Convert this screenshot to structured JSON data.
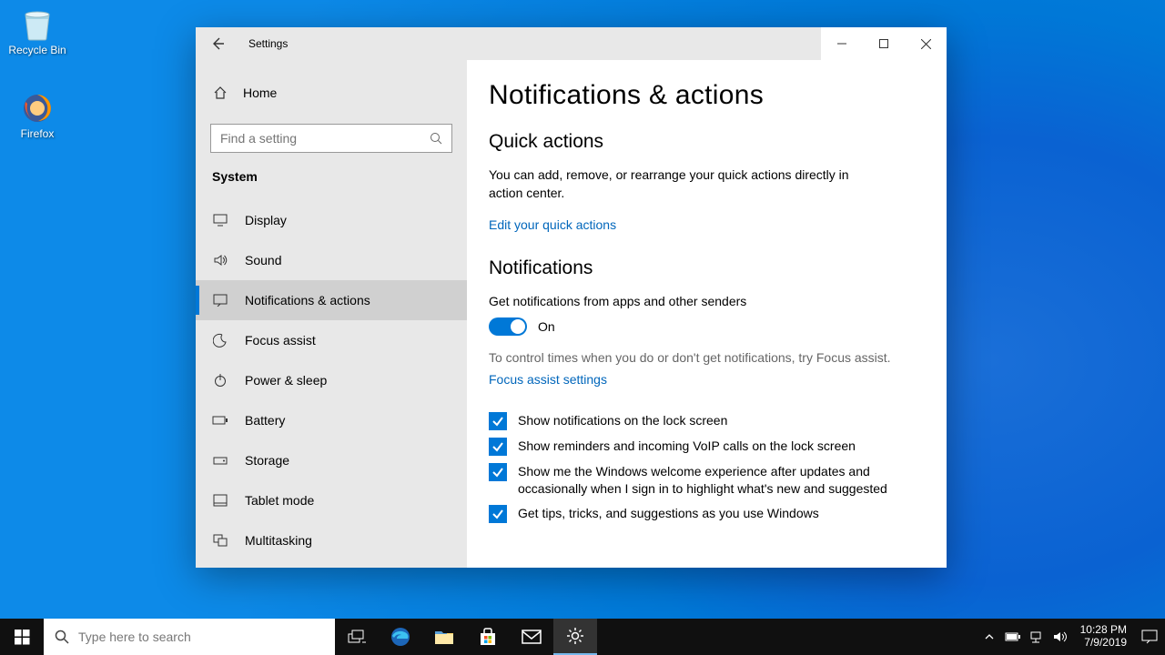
{
  "desktop": {
    "recycle": "Recycle Bin",
    "firefox": "Firefox"
  },
  "window": {
    "title": "Settings",
    "home": "Home",
    "search_placeholder": "Find a setting",
    "category": "System",
    "nav": [
      "Display",
      "Sound",
      "Notifications & actions",
      "Focus assist",
      "Power & sleep",
      "Battery",
      "Storage",
      "Tablet mode",
      "Multitasking"
    ]
  },
  "main": {
    "title": "Notifications & actions",
    "qa_heading": "Quick actions",
    "qa_desc": "You can add, remove, or rearrange your quick actions directly in action center.",
    "qa_link": "Edit your quick actions",
    "notif_heading": "Notifications",
    "notif_label": "Get notifications from apps and other senders",
    "toggle_state": "On",
    "focus_hint": "To control times when you do or don't get notifications, try Focus assist.",
    "focus_link": "Focus assist settings",
    "checks": [
      "Show notifications on the lock screen",
      "Show reminders and incoming VoIP calls on the lock screen",
      "Show me the Windows welcome experience after updates and occasionally when I sign in to highlight what's new and suggested",
      "Get tips, tricks, and suggestions as you use Windows"
    ]
  },
  "taskbar": {
    "search_placeholder": "Type here to search",
    "time": "10:28 PM",
    "date": "7/9/2019"
  }
}
